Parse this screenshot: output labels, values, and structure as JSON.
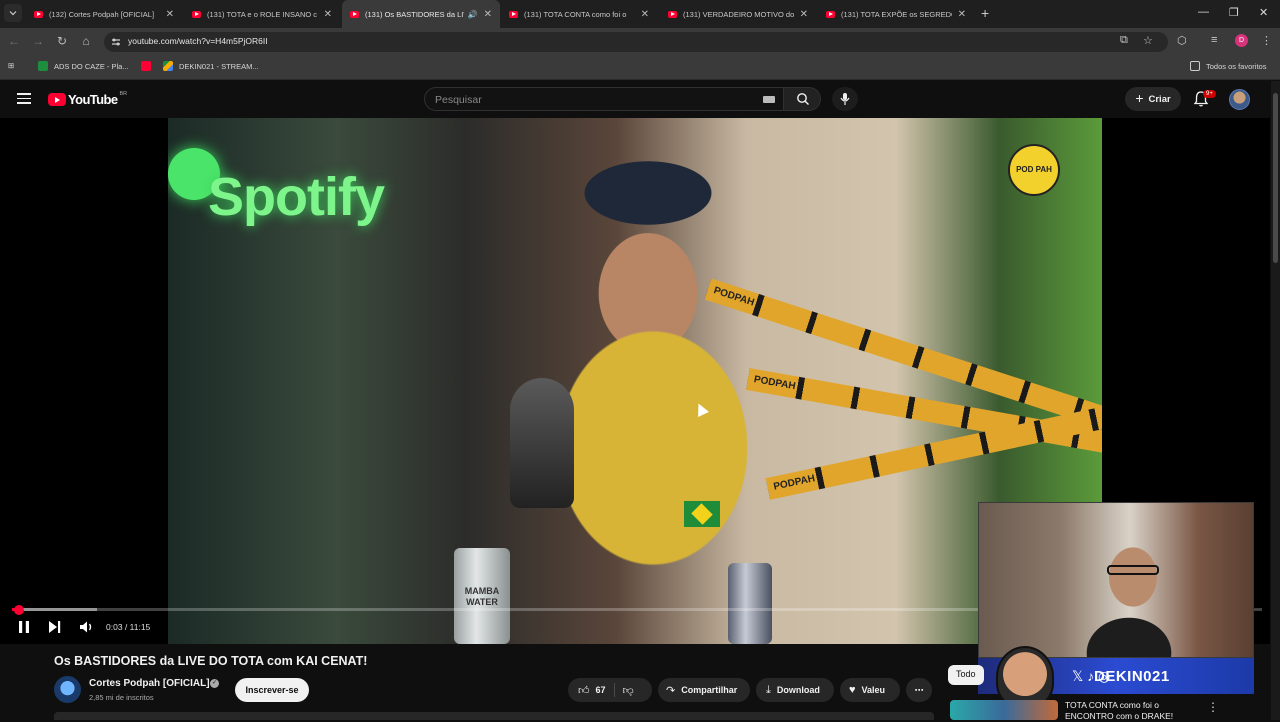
{
  "browser": {
    "tabs": [
      {
        "title": "(132) Cortes Podpah [OFICIAL]",
        "active": false
      },
      {
        "title": "(131) TOTA e o ROLE INSANO c",
        "active": false
      },
      {
        "title": "(131) Os BASTIDORES da LIV",
        "active": true
      },
      {
        "title": "(131) TOTA CONTA como foi o",
        "active": false
      },
      {
        "title": "(131) VERDADEIRO MOTIVO do",
        "active": false
      },
      {
        "title": "(131) TOTA EXPÕE os SEGREDO",
        "active": false
      }
    ],
    "url": "youtube.com/watch?v=H4m5PjOR6II",
    "profile_initial": "D",
    "bookmarks": [
      {
        "label": "ADS DO CAZE - Pla...",
        "icon": "sheets-icon",
        "color": "#1e8e3e"
      },
      {
        "label": "",
        "icon": "youtube-icon",
        "color": "#ff0033"
      },
      {
        "label": "DEKIN021 - STREAM...",
        "icon": "drive-icon",
        "color": "#f9ab00"
      }
    ],
    "all_bookmarks": "Todos os favoritos"
  },
  "youtube": {
    "logo_word": "YouTube",
    "country_code": "BR",
    "search_placeholder": "Pesquisar",
    "create_label": "Criar",
    "notification_badge": "9+"
  },
  "player": {
    "time_current": "0:03",
    "time_total": "11:15",
    "time_display": "0:03 / 11:15",
    "progress_fraction": 0.0044,
    "buffer_fraction": 0.068,
    "overlay_text_spotify": "Spotify",
    "overlay_podpah_logo": "POD PAH",
    "tape_label": "PODPAH",
    "can_label": "MAMBA WATER",
    "stream_brand": "DEKIN021",
    "stream_social": "𝕏 ♪ ◎"
  },
  "video": {
    "title": "Os BASTIDORES da LIVE DO TOTA com KAI CENAT!",
    "channel_name": "Cortes Podpah [OFICIAL]",
    "subscribers": "2,85 mi de inscritos",
    "subscribe_label": "Inscrever-se",
    "likes": "67",
    "share_label": "Compartilhar",
    "download_label": "Download",
    "thanks_label": "Valeu",
    "more_label": "⋯"
  },
  "sidebar": {
    "chip_label": "Todo",
    "next_video_title": "TOTA CONTA como foi o ENCONTRO com o DRAKE!"
  },
  "colors": {
    "accent": "#ff0033",
    "background": "#0f0f0f",
    "chrome_toolbar": "#3a3a3a"
  }
}
